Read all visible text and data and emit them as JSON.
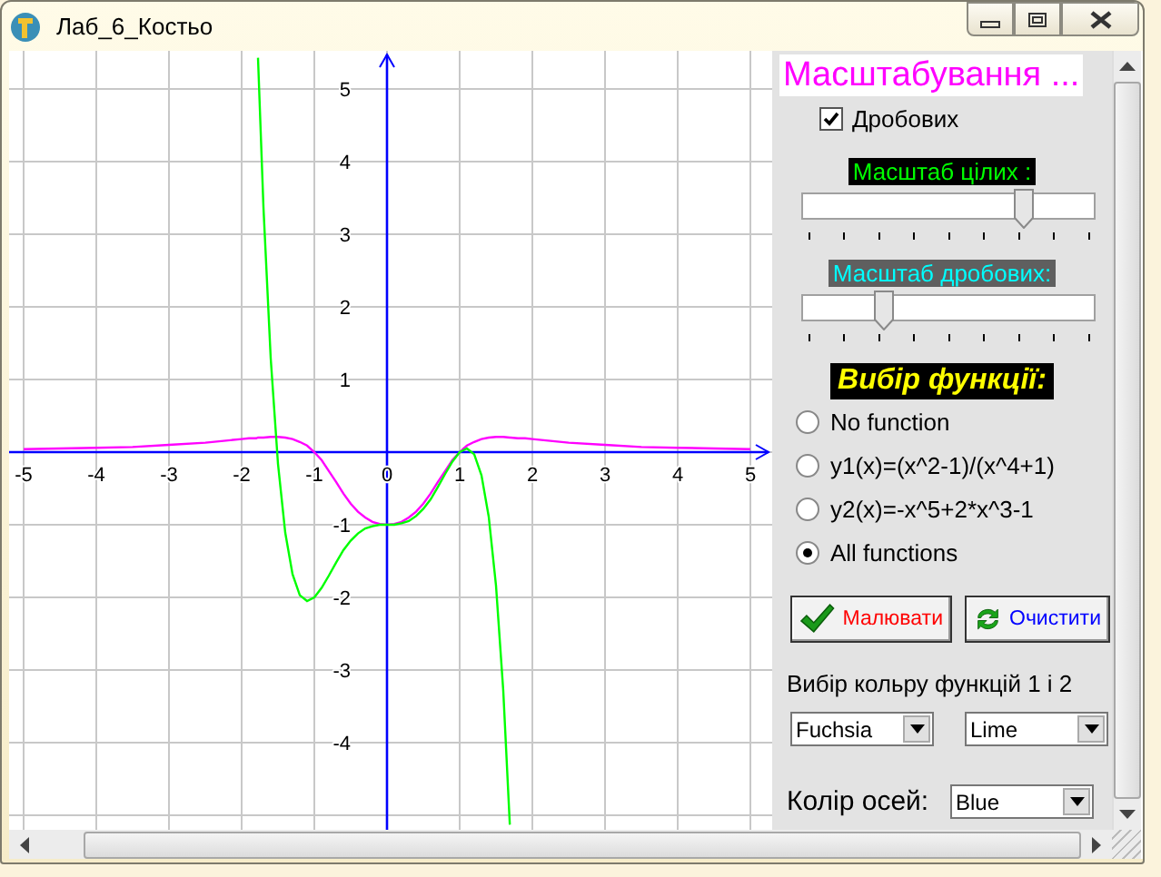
{
  "window": {
    "title": "Лаб_6_Костьо"
  },
  "plot": {
    "chart_data": {
      "type": "line",
      "x": [
        -5,
        -4.5,
        -4,
        -3.5,
        -3,
        -2.5,
        -2,
        -1.9,
        -1.8,
        -1.775,
        -1.7,
        -1.6,
        -1.5,
        -1.4,
        -1.3,
        -1.2,
        -1.1,
        -1,
        -0.9,
        -0.8,
        -0.7,
        -0.6,
        -0.5,
        -0.4,
        -0.3,
        -0.2,
        -0.1,
        0,
        0.1,
        0.2,
        0.3,
        0.4,
        0.5,
        0.6,
        0.7,
        0.8,
        0.9,
        1,
        1.1,
        1.2,
        1.3,
        1.4,
        1.5,
        1.6,
        1.69,
        1.7,
        1.8,
        1.9,
        2,
        2.5,
        3,
        3.5,
        4,
        4.5,
        5
      ],
      "series": [
        {
          "color": "#ff00ff",
          "values": [
            0.04,
            0.05,
            0.06,
            0.07,
            0.1,
            0.13,
            0.18,
            0.19,
            0.19,
            0.2,
            0.2,
            0.21,
            0.21,
            0.2,
            0.18,
            0.14,
            0.09,
            0,
            -0.11,
            -0.26,
            -0.41,
            -0.57,
            -0.71,
            -0.82,
            -0.9,
            -0.96,
            -0.99,
            -1,
            -0.99,
            -0.96,
            -0.9,
            -0.82,
            -0.71,
            -0.57,
            -0.41,
            -0.26,
            -0.11,
            0,
            0.09,
            0.14,
            0.18,
            0.2,
            0.21,
            0.21,
            0.2,
            0.2,
            0.19,
            0.19,
            0.18,
            0.13,
            0.1,
            0.07,
            0.06,
            0.05,
            0.04
          ]
        },
        {
          "color": "#00ff00",
          "values": [
            null,
            null,
            null,
            null,
            null,
            null,
            null,
            null,
            null,
            5.43,
            3.37,
            1.29,
            -0.16,
            -1.11,
            -1.68,
            -1.97,
            -2.05,
            -2,
            -1.87,
            -1.7,
            -1.52,
            -1.35,
            -1.22,
            -1.12,
            -1.05,
            -1.02,
            -1,
            -1,
            -1,
            -0.98,
            -0.95,
            -0.88,
            -0.78,
            -0.65,
            -0.48,
            -0.3,
            -0.13,
            0,
            0.05,
            -0.03,
            -0.32,
            -0.89,
            -1.84,
            -3.29,
            -5.13,
            null,
            null,
            null,
            null,
            null,
            null,
            null,
            null,
            null,
            null
          ]
        }
      ],
      "grid": true,
      "xlim": [
        -5.2,
        5.3
      ],
      "ylim": [
        -5.2,
        5.525
      ],
      "xticks": [
        -5,
        -4,
        -3,
        -2,
        -1,
        0,
        1,
        2,
        3,
        4,
        5
      ],
      "yticks": [
        -4,
        -3,
        -2,
        -1,
        1,
        2,
        3,
        4,
        5
      ]
    }
  },
  "scaling": {
    "title": "Масштабування ...",
    "checkbox": {
      "label": "Дробових",
      "checked": true
    },
    "sliders": [
      {
        "label": "Масштаб цілих :",
        "level": 0.75
      },
      {
        "label": "Масштаб дробових:",
        "level": 0.28
      }
    ]
  },
  "function_choice": {
    "title": "Вибір функції:",
    "options": [
      {
        "label": "No function",
        "selected": false
      },
      {
        "label": "y1(x)=(x^2-1)/(x^4+1)",
        "selected": false
      },
      {
        "label": "y2(x)=-x^5+2*x^3-1",
        "selected": false
      },
      {
        "label": "All functions",
        "selected": true
      }
    ]
  },
  "buttons": [
    {
      "label": "Малювати",
      "kind": "draw"
    },
    {
      "label": "Очистити",
      "kind": "clear"
    }
  ],
  "color_choice": {
    "label": "Вибір кольру функцій 1 і 2",
    "dropdowns": [
      "Fuchsia",
      "Lime"
    ]
  },
  "axis_color": {
    "label": "Колір осей:",
    "value": "Blue"
  }
}
